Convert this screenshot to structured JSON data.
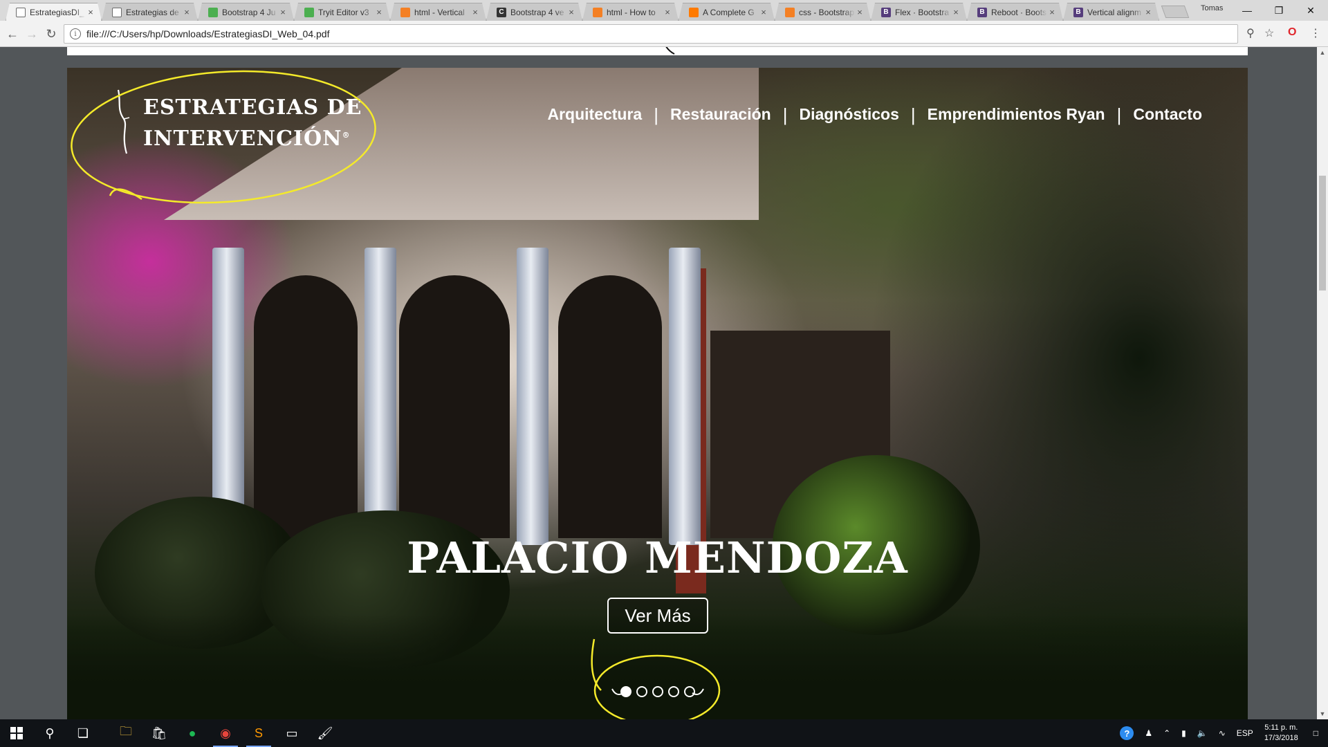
{
  "browser": {
    "tabs": [
      {
        "title": "EstrategiasDI_",
        "icon": "document-icon",
        "color": "#6b6b6b",
        "active": true
      },
      {
        "title": "Estrategias de",
        "icon": "document-icon",
        "color": "#6b6b6b",
        "active": false
      },
      {
        "title": "Bootstrap 4 Ju",
        "icon": "tryit-icon",
        "color": "#4caf50",
        "active": false
      },
      {
        "title": "Tryit Editor v3",
        "icon": "tryit-icon",
        "color": "#4caf50",
        "active": false
      },
      {
        "title": "html - Vertical",
        "icon": "stackoverflow-icon",
        "color": "#f48024",
        "active": false
      },
      {
        "title": "Bootstrap 4 ve",
        "icon": "codeply-icon",
        "color": "#333333",
        "active": false
      },
      {
        "title": "html - How to",
        "icon": "stackoverflow-icon",
        "color": "#f48024",
        "active": false
      },
      {
        "title": "A Complete G",
        "icon": "csstricks-icon",
        "color": "#ff7a00",
        "active": false
      },
      {
        "title": "css - Bootstrap",
        "icon": "stackoverflow-icon",
        "color": "#f48024",
        "active": false
      },
      {
        "title": "Flex · Bootstra",
        "icon": "bootstrap-icon",
        "color": "#563d7c",
        "active": false
      },
      {
        "title": "Reboot · Boots",
        "icon": "bootstrap-icon",
        "color": "#563d7c",
        "active": false
      },
      {
        "title": "Vertical alignm",
        "icon": "bootstrap-icon",
        "color": "#563d7c",
        "active": false
      }
    ],
    "profile_name": "Tomas",
    "address": "file:///C:/Users/hp/Downloads/EstrategiasDI_Web_04.pdf"
  },
  "site": {
    "logo_line1": "ESTRATEGIAS DE",
    "logo_line2": "INTERVENCIÓN",
    "logo_mark": "®",
    "nav": [
      "Arquitectura",
      "Restauración",
      "Diagnósticos",
      "Emprendimientos Ryan",
      "Contacto"
    ],
    "nav_separator": "|",
    "hero_title": "PALACIO MENDOZA",
    "cta_label": "Ver Más",
    "carousel_slides": 5,
    "carousel_active": 1
  },
  "annotation_color": "#f4ea2a",
  "taskbar": {
    "apps": [
      {
        "name": "file-explorer-icon",
        "glyph": "🗀",
        "color": "#f5c542",
        "open": false
      },
      {
        "name": "store-icon",
        "glyph": "🛍",
        "color": "#ffffff",
        "open": false
      },
      {
        "name": "spotify-icon",
        "glyph": "●",
        "color": "#1db954",
        "open": false
      },
      {
        "name": "chrome-icon",
        "glyph": "◉",
        "color": "#e8453c",
        "open": true
      },
      {
        "name": "sublime-text-icon",
        "glyph": "S",
        "color": "#ff9800",
        "open": true
      },
      {
        "name": "terminal-icon",
        "glyph": "▭",
        "color": "#ffffff",
        "open": false
      },
      {
        "name": "paint-icon",
        "glyph": "🖌",
        "color": "#ffffff",
        "open": false
      }
    ],
    "language": "ESP",
    "time": "5:11 p. m.",
    "date": "17/3/2018"
  }
}
